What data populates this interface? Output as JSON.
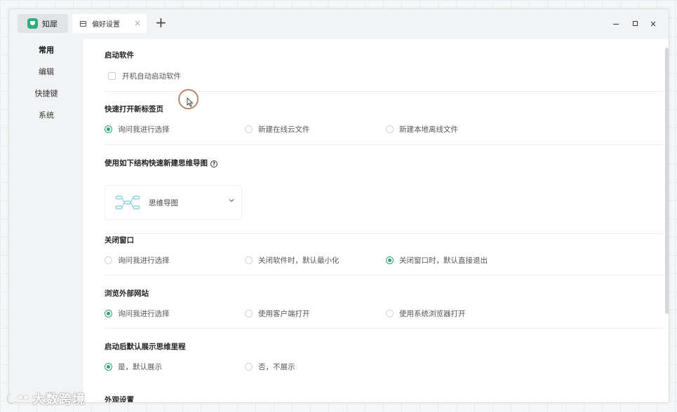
{
  "titlebar": {
    "app_name": "知犀",
    "tab_label": "偏好设置",
    "tab_close": "×",
    "new_tab": "+"
  },
  "window_controls": {
    "close": "×"
  },
  "sidebar": {
    "items": [
      {
        "label": "常用",
        "active": true
      },
      {
        "label": "编辑"
      },
      {
        "label": "快捷键"
      },
      {
        "label": "系统"
      }
    ]
  },
  "sections": {
    "startup": {
      "title": "启动软件",
      "checkbox_label": "开机自动启动软件",
      "checked": false
    },
    "quick_open": {
      "title": "快速打开新标签页",
      "options": [
        "询问我进行选择",
        "新建在线云文件",
        "新建本地离线文件"
      ],
      "selected": 0
    },
    "structure": {
      "title": "使用如下结构快速新建思维导图",
      "help": "?",
      "selected_value": "思维导图"
    },
    "close_window": {
      "title": "关闭窗口",
      "options": [
        "询问我进行选择",
        "关闭软件时，默认最小化",
        "关闭窗口时，默认直接退出"
      ],
      "selected": 2
    },
    "browse_external": {
      "title": "浏览外部网站",
      "options": [
        "询问我进行选择",
        "使用客户端打开",
        "使用系统浏览器打开"
      ],
      "selected": 0
    },
    "show_process": {
      "title": "启动后默认展示思维里程",
      "options": [
        "是，默认展示",
        "否，不展示"
      ],
      "selected": 0
    },
    "appearance": {
      "title": "外观设置"
    }
  },
  "watermark": {
    "text": "大数跨境"
  },
  "colors": {
    "accent": "#2ea171",
    "brand": "#29b07a",
    "sidebar_bg": "#f2f3f5"
  }
}
